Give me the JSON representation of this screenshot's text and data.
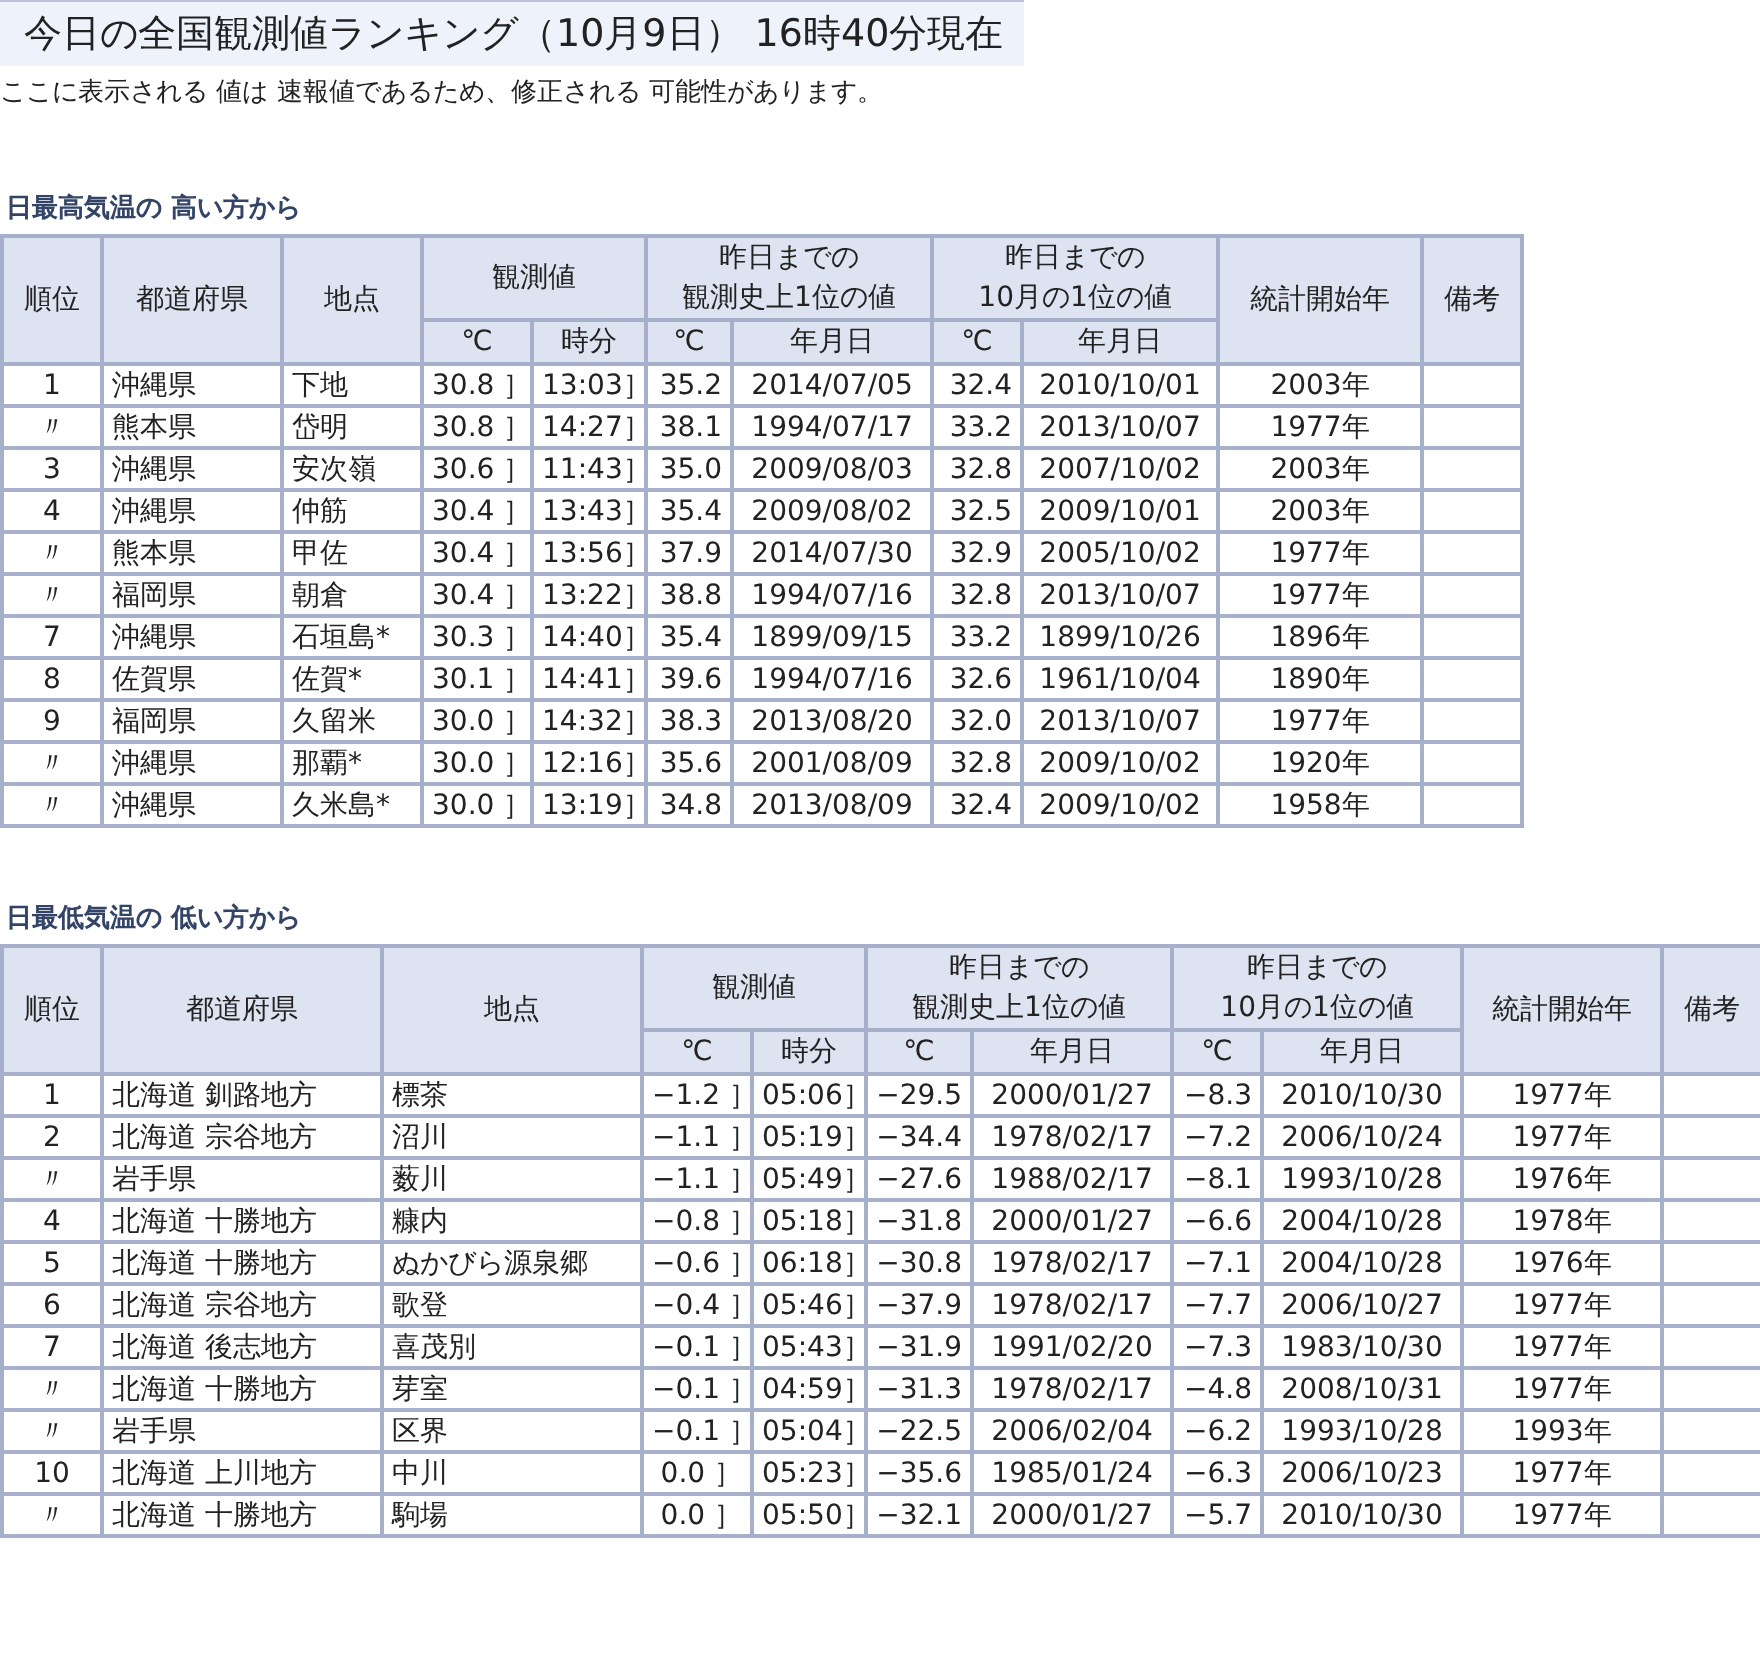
{
  "title": "今日の全国観測値ランキング（10月9日） 16時40分現在",
  "note": "ここに表示される 値は 速報値であるため、修正される 可能性があります。",
  "sections": [
    {
      "heading": "日最高気温の 高い方から",
      "columns": {
        "rank": "順位",
        "prefecture": "都道府県",
        "place": "地点",
        "observed": {
          "label": [
            "観測値"
          ],
          "temp": "℃",
          "time": "時分"
        },
        "record": {
          "label": [
            "昨日までの",
            "観測史上1位の値"
          ],
          "temp": "℃",
          "date": "年月日"
        },
        "month_record": {
          "label": [
            "昨日までの",
            "10月の1位の値"
          ],
          "temp": "℃",
          "date": "年月日"
        },
        "start_year": "統計開始年",
        "remarks": "備考"
      },
      "rows": [
        [
          "1",
          "沖縄県",
          "下地",
          "30.8 ］",
          "13:03］",
          "35.2",
          "2014/07/05",
          "32.4",
          "2010/10/01",
          "2003年"
        ],
        [
          "〃",
          "熊本県",
          "岱明",
          "30.8 ］",
          "14:27］",
          "38.1",
          "1994/07/17",
          "33.2",
          "2013/10/07",
          "1977年"
        ],
        [
          "3",
          "沖縄県",
          "安次嶺",
          "30.6 ］",
          "11:43］",
          "35.0",
          "2009/08/03",
          "32.8",
          "2007/10/02",
          "2003年"
        ],
        [
          "4",
          "沖縄県",
          "仲筋",
          "30.4 ］",
          "13:43］",
          "35.4",
          "2009/08/02",
          "32.5",
          "2009/10/01",
          "2003年"
        ],
        [
          "〃",
          "熊本県",
          "甲佐",
          "30.4 ］",
          "13:56］",
          "37.9",
          "2014/07/30",
          "32.9",
          "2005/10/02",
          "1977年"
        ],
        [
          "〃",
          "福岡県",
          "朝倉",
          "30.4 ］",
          "13:22］",
          "38.8",
          "1994/07/16",
          "32.8",
          "2013/10/07",
          "1977年"
        ],
        [
          "7",
          "沖縄県",
          "石垣島*",
          "30.3 ］",
          "14:40］",
          "35.4",
          "1899/09/15",
          "33.2",
          "1899/10/26",
          "1896年"
        ],
        [
          "8",
          "佐賀県",
          "佐賀*",
          "30.1 ］",
          "14:41］",
          "39.6",
          "1994/07/16",
          "32.6",
          "1961/10/04",
          "1890年"
        ],
        [
          "9",
          "福岡県",
          "久留米",
          "30.0 ］",
          "14:32］",
          "38.3",
          "2013/08/20",
          "32.0",
          "2013/10/07",
          "1977年"
        ],
        [
          "〃",
          "沖縄県",
          "那覇*",
          "30.0 ］",
          "12:16］",
          "35.6",
          "2001/08/09",
          "32.8",
          "2009/10/02",
          "1920年"
        ],
        [
          "〃",
          "沖縄県",
          "久米島*",
          "30.0 ］",
          "13:19］",
          "34.8",
          "2013/08/09",
          "32.4",
          "2009/10/02",
          "1958年"
        ]
      ]
    },
    {
      "heading": "日最低気温の 低い方から",
      "columns": {
        "rank": "順位",
        "prefecture": "都道府県",
        "place": "地点",
        "observed": {
          "label": [
            "観測値"
          ],
          "temp": "℃",
          "time": "時分"
        },
        "record": {
          "label": [
            "昨日までの",
            "観測史上1位の値"
          ],
          "temp": "℃",
          "date": "年月日"
        },
        "month_record": {
          "label": [
            "昨日までの",
            "10月の1位の値"
          ],
          "temp": "℃",
          "date": "年月日"
        },
        "start_year": "統計開始年",
        "remarks": "備考"
      },
      "rows": [
        [
          "1",
          "北海道 釧路地方",
          "標茶",
          "−1.2 ］",
          "05:06］",
          "−29.5",
          "2000/01/27",
          "−8.3",
          "2010/10/30",
          "1977年"
        ],
        [
          "2",
          "北海道 宗谷地方",
          "沼川",
          "−1.1 ］",
          "05:19］",
          "−34.4",
          "1978/02/17",
          "−7.2",
          "2006/10/24",
          "1977年"
        ],
        [
          "〃",
          "岩手県",
          "薮川",
          "−1.1 ］",
          "05:49］",
          "−27.6",
          "1988/02/17",
          "−8.1",
          "1993/10/28",
          "1976年"
        ],
        [
          "4",
          "北海道 十勝地方",
          "糠内",
          "−0.8 ］",
          "05:18］",
          "−31.8",
          "2000/01/27",
          "−6.6",
          "2004/10/28",
          "1978年"
        ],
        [
          "5",
          "北海道 十勝地方",
          "ぬかびら源泉郷",
          "−0.6 ］",
          "06:18］",
          "−30.8",
          "1978/02/17",
          "−7.1",
          "2004/10/28",
          "1976年"
        ],
        [
          "6",
          "北海道 宗谷地方",
          "歌登",
          "−0.4 ］",
          "05:46］",
          "−37.9",
          "1978/02/17",
          "−7.7",
          "2006/10/27",
          "1977年"
        ],
        [
          "7",
          "北海道 後志地方",
          "喜茂別",
          "−0.1 ］",
          "05:43］",
          "−31.9",
          "1991/02/20",
          "−7.3",
          "1983/10/30",
          "1977年"
        ],
        [
          "〃",
          "北海道 十勝地方",
          "芽室",
          "−0.1 ］",
          "04:59］",
          "−31.3",
          "1978/02/17",
          "−4.8",
          "2008/10/31",
          "1977年"
        ],
        [
          "〃",
          "岩手県",
          "区界",
          "−0.1 ］",
          "05:04］",
          "−22.5",
          "2006/02/04",
          "−6.2",
          "1993/10/28",
          "1993年"
        ],
        [
          "10",
          "北海道 上川地方",
          "中川",
          "0.0 ］",
          "05:23］",
          "−35.6",
          "1985/01/24",
          "−6.3",
          "2006/10/23",
          "1977年"
        ],
        [
          "〃",
          "北海道 十勝地方",
          "駒場",
          "0.0 ］",
          "05:50］",
          "−32.1",
          "2000/01/27",
          "−5.7",
          "2010/10/30",
          "1977年"
        ]
      ]
    }
  ]
}
